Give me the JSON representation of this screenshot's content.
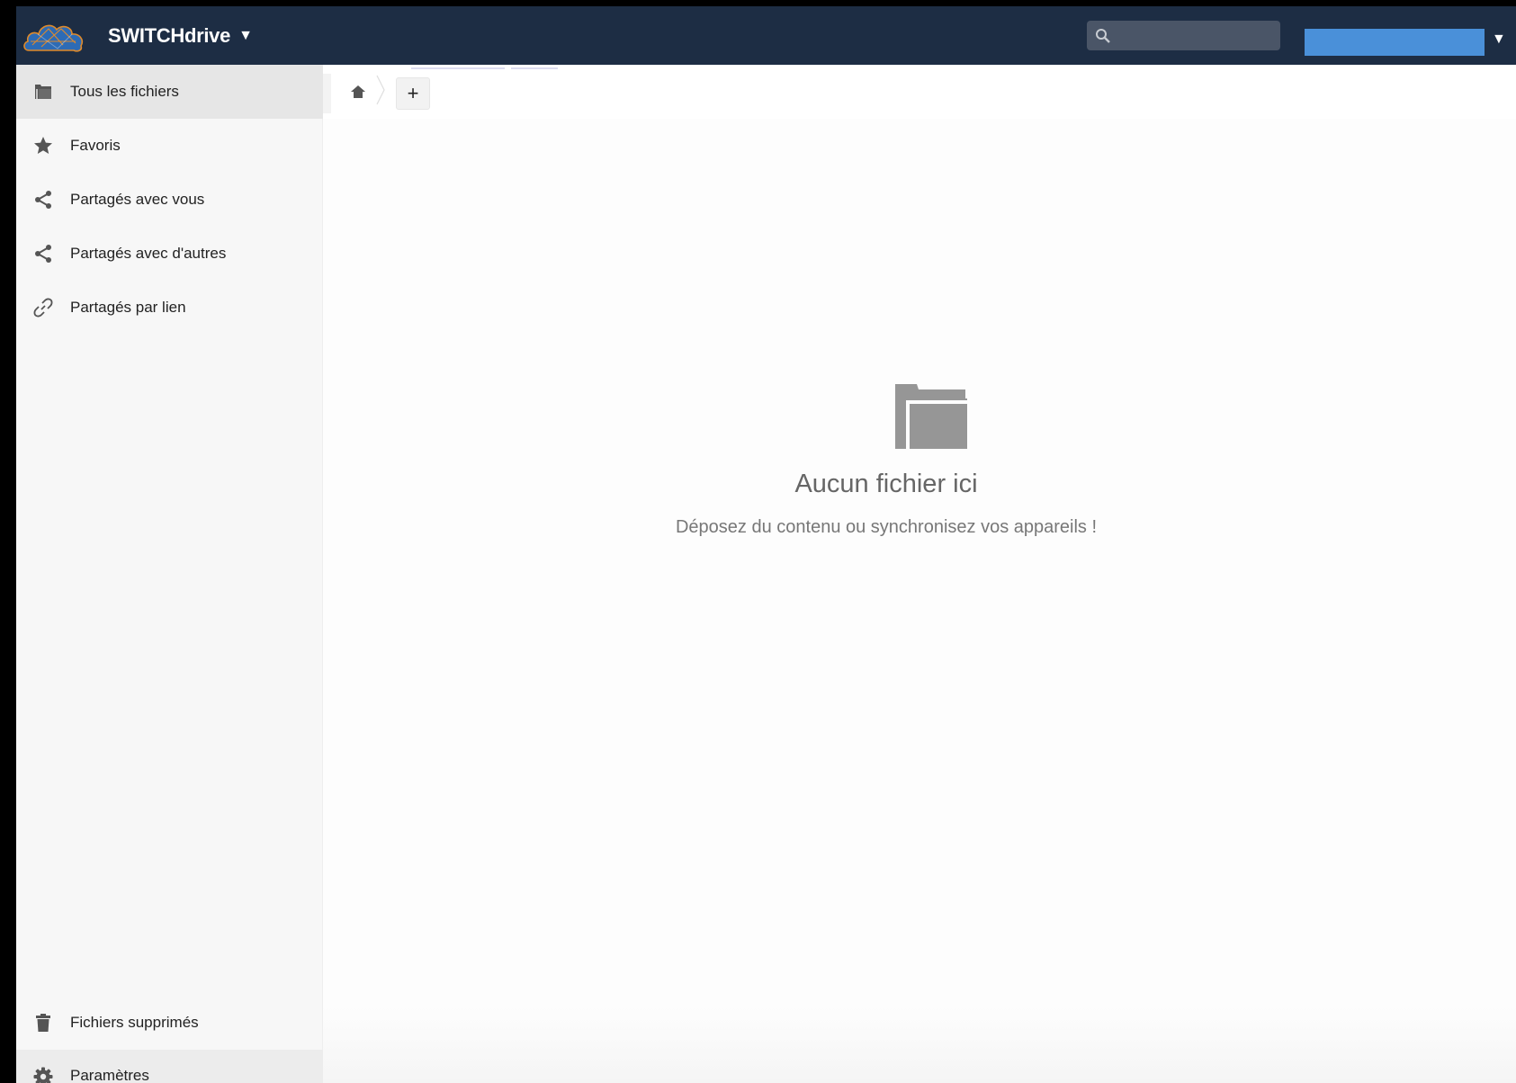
{
  "header": {
    "app_name": "SWITCHdrive",
    "app_caret": "▼",
    "search": {
      "value": "",
      "placeholder": ""
    },
    "user": {
      "name": "",
      "caret": "▼"
    },
    "colors": {
      "bar": "#1d2d44",
      "search_bg": "#4a5567",
      "user_highlight": "#4a90d9"
    }
  },
  "sidebar": {
    "items": [
      {
        "label": "Tous les fichiers",
        "icon": "folder-icon",
        "active": true
      },
      {
        "label": "Favoris",
        "icon": "star-icon",
        "active": false
      },
      {
        "label": "Partagés avec vous",
        "icon": "share-icon",
        "active": false
      },
      {
        "label": "Partagés avec d'autres",
        "icon": "share-icon",
        "active": false
      },
      {
        "label": "Partagés par lien",
        "icon": "link-icon",
        "active": false
      }
    ],
    "trash": {
      "label": "Fichiers supprimés",
      "icon": "trash-icon"
    },
    "settings": {
      "label": "Paramètres",
      "icon": "gear-icon"
    }
  },
  "controls": {
    "breadcrumb_home_icon": "home-icon",
    "new_button_label": "+"
  },
  "empty_state": {
    "icon": "folder-icon",
    "title": "Aucun fichier ici",
    "subtitle": "Déposez du contenu ou synchronisez vos appareils !"
  }
}
